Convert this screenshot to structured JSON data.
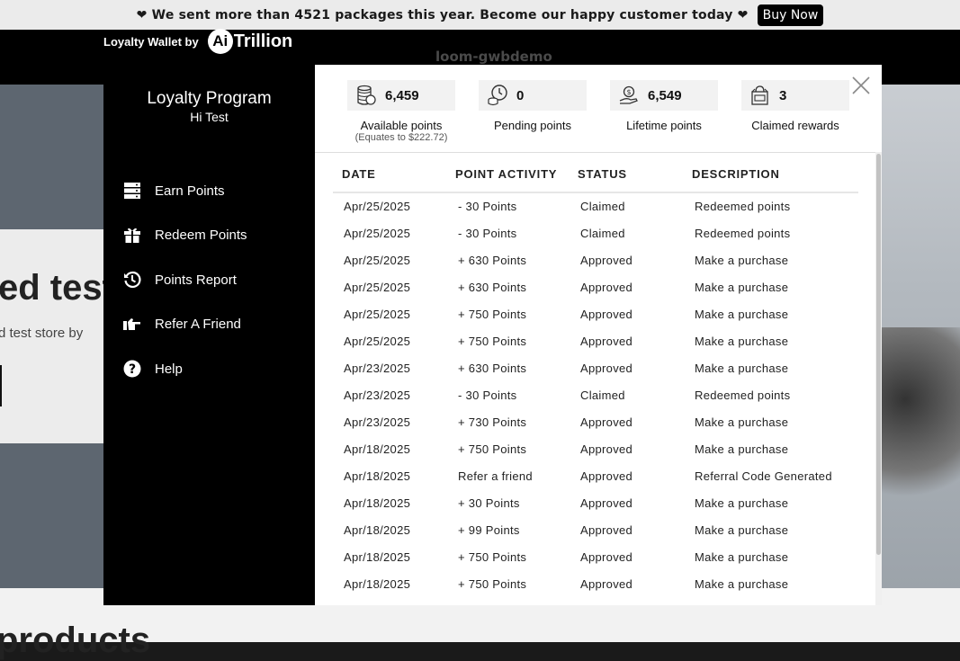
{
  "announcement": {
    "text": "❤ We sent more than 4521 packages this year. Become our happy customer today ❤",
    "button": "Buy Now"
  },
  "store": {
    "name": "loom-gwbdemo",
    "hero_title": "ed test",
    "hero_subtitle": "d test store by",
    "bottom_title": "products"
  },
  "wallet": {
    "brand_prefix": "Loyalty Wallet by",
    "logo_circle": "Ai",
    "logo_word": "Trillion"
  },
  "sidebar": {
    "title": "Loyalty Program",
    "greeting": "Hi Test",
    "items": [
      {
        "label": "Earn Points",
        "icon": "earn-points-icon"
      },
      {
        "label": "Redeem Points",
        "icon": "gift-icon"
      },
      {
        "label": "Points Report",
        "icon": "history-icon"
      },
      {
        "label": "Refer A Friend",
        "icon": "pointing-hand-icon"
      },
      {
        "label": "Help",
        "icon": "help-icon"
      }
    ]
  },
  "stats": [
    {
      "value": "6,459",
      "label": "Available points",
      "note": "(Equates to $222.72)",
      "icon": "coins-icon"
    },
    {
      "value": "0",
      "label": "Pending points",
      "icon": "clock-coins-icon"
    },
    {
      "value": "6,549",
      "label": "Lifetime points",
      "icon": "hand-coin-icon"
    },
    {
      "value": "3",
      "label": "Claimed rewards",
      "icon": "rewards-bag-icon"
    }
  ],
  "table": {
    "headers": [
      "DATE",
      "POINT ACTIVITY",
      "STATUS",
      "DESCRIPTION"
    ],
    "rows": [
      [
        "Apr/25/2025",
        "- 30 Points",
        "Claimed",
        "Redeemed points"
      ],
      [
        "Apr/25/2025",
        "- 30 Points",
        "Claimed",
        "Redeemed points"
      ],
      [
        "Apr/25/2025",
        "+ 630 Points",
        "Approved",
        "Make a purchase"
      ],
      [
        "Apr/25/2025",
        "+ 630 Points",
        "Approved",
        "Make a purchase"
      ],
      [
        "Apr/25/2025",
        "+ 750 Points",
        "Approved",
        "Make a purchase"
      ],
      [
        "Apr/25/2025",
        "+ 750 Points",
        "Approved",
        "Make a purchase"
      ],
      [
        "Apr/23/2025",
        "+ 630 Points",
        "Approved",
        "Make a purchase"
      ],
      [
        "Apr/23/2025",
        "- 30 Points",
        "Claimed",
        "Redeemed points"
      ],
      [
        "Apr/23/2025",
        "+ 730 Points",
        "Approved",
        "Make a purchase"
      ],
      [
        "Apr/18/2025",
        "+ 750 Points",
        "Approved",
        "Make a purchase"
      ],
      [
        "Apr/18/2025",
        "Refer a friend",
        "Approved",
        "Referral Code Generated"
      ],
      [
        "Apr/18/2025",
        "+ 30 Points",
        "Approved",
        "Make a purchase"
      ],
      [
        "Apr/18/2025",
        "+ 99 Points",
        "Approved",
        "Make a purchase"
      ],
      [
        "Apr/18/2025",
        "+ 750 Points",
        "Approved",
        "Make a purchase"
      ],
      [
        "Apr/18/2025",
        "+ 750 Points",
        "Approved",
        "Make a purchase"
      ]
    ]
  }
}
